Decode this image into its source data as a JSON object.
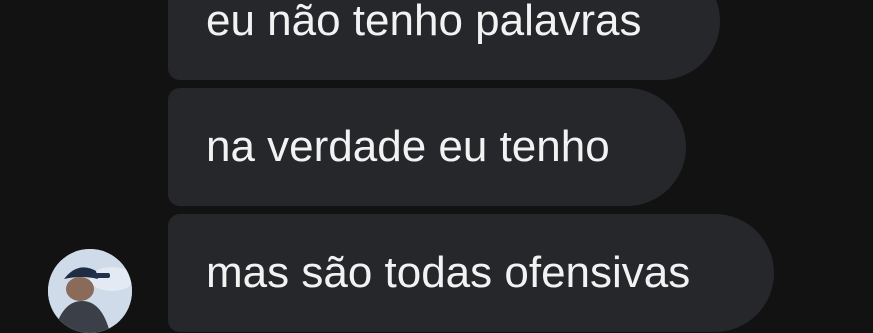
{
  "messages": [
    {
      "text": "eu não tenho palavras"
    },
    {
      "text": "na verdade eu tenho"
    },
    {
      "text": "mas são todas ofensivas"
    }
  ],
  "colors": {
    "background": "#121212",
    "bubble": "#26272b",
    "text": "#f2f2f2"
  },
  "sender": {
    "avatar_icon": "user-photo-avatar"
  }
}
